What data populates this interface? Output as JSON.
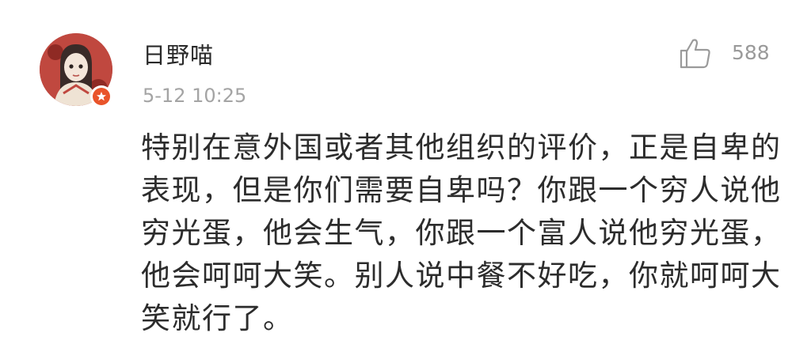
{
  "comment": {
    "username": "日野喵",
    "timestamp": "5-12 10:25",
    "like_count": "588",
    "body": "特别在意外国或者其他组织的评价，正是自卑的表现，但是你们需要自卑吗？你跟一个穷人说他穷光蛋，他会生气，你跟一个富人说他穷光蛋，他会呵呵大笑。别人说中餐不好吃，你就呵呵大笑就行了。"
  },
  "icons": {
    "like": "thumbs-up-icon",
    "badge": "vip-star-icon"
  },
  "colors": {
    "text_primary": "#2c2c2c",
    "text_secondary": "#a4a4a4",
    "badge": "#e9542a"
  }
}
